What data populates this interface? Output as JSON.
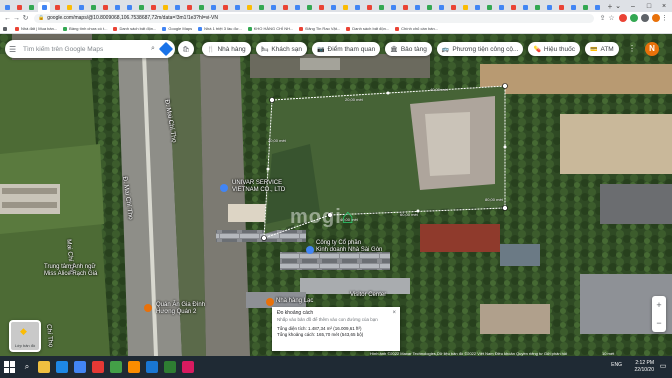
{
  "browser": {
    "url": "google.com/maps/@10.8009068,106.7538687,72m/data=!3m1!1e3?hl=vi-VN",
    "tab_favicon_colors": [
      "#4285f4",
      "#ea4335",
      "#34a853",
      "#4285f4",
      "#ea4335",
      "#fbbc04",
      "#4285f4",
      "#34a853",
      "#ea4335",
      "#4285f4",
      "#4285f4",
      "#34a853",
      "#ea4335",
      "#fbbc04",
      "#4285f4",
      "#ea4335",
      "#34a853",
      "#4285f4",
      "#ea4335",
      "#4285f4",
      "#fbbc04",
      "#34a853",
      "#4285f4",
      "#ea4335",
      "#4285f4",
      "#34a853",
      "#ea4335",
      "#4285f4",
      "#fbbc04",
      "#4285f4",
      "#ea4335",
      "#34a853",
      "#4285f4",
      "#ea4335",
      "#4285f4",
      "#34a853",
      "#4285f4",
      "#ea4335",
      "#fbbc04",
      "#4285f4",
      "#34a853",
      "#4285f4",
      "#ea4335",
      "#4285f4",
      "#34a853",
      "#4285f4",
      "#ea4335",
      "#4285f4",
      "#34a853",
      "#4285f4"
    ],
    "bookmarks": [
      {
        "label": "Nhà đất | Mua bán...",
        "style": "red"
      },
      {
        "label": "Bảng tính chưa có t...",
        "style": "green"
      },
      {
        "label": "Danh sách bất độn...",
        "style": "red"
      },
      {
        "label": "Google Maps",
        "style": "blue"
      },
      {
        "label": "Nhà 1 triệt 3 lầu đư...",
        "style": "blue"
      },
      {
        "label": "KHO HÀNG CHÍ NH...",
        "style": "green"
      },
      {
        "label": "Đăng Tin Rao Vặt...",
        "style": "red"
      },
      {
        "label": "Danh sách bất độn...",
        "style": "red"
      },
      {
        "label": "Chính chủ cần bán...",
        "style": "red"
      }
    ],
    "other_bookmarks": "Dấu trang khác"
  },
  "maps": {
    "search_placeholder": "Tìm kiếm trên Google Maps",
    "chips": [
      {
        "icon": "restaurant-icon",
        "glyph": "🍴",
        "label": "Nhà hàng"
      },
      {
        "icon": "hotel-icon",
        "glyph": "🛏",
        "label": "Khách sạn"
      },
      {
        "icon": "camera-icon",
        "glyph": "📷",
        "label": "Điểm tham quan"
      },
      {
        "icon": "museum-icon",
        "glyph": "🏛",
        "label": "Bảo tàng"
      },
      {
        "icon": "transit-icon",
        "glyph": "🚌",
        "label": "Phương tiện công cộ..."
      },
      {
        "icon": "pharmacy-icon",
        "glyph": "💊",
        "label": "Hiệu thuốc"
      },
      {
        "icon": "atm-icon",
        "glyph": "💳",
        "label": "ATM"
      }
    ],
    "avatar_letter": "N",
    "roads": [
      "Đ. Mai Chí Thọ",
      "Đ. Mai Chí Thọ",
      "Mai Chí Thọ",
      "Chí Thọ"
    ],
    "places": [
      {
        "name": "UNIVAR SERVICE",
        "sub": "VIETNAM CO., LTD"
      },
      {
        "name": "Công ty Cổ phần",
        "sub": "Kinh doanh Nhà Sài Gòn"
      },
      {
        "name": "Trung tâm Anh ngữ",
        "sub": "Miss Alice Rạch Giá"
      },
      {
        "name": "Quán Ăn Gia Đình",
        "sub": "Hương Quán 2"
      },
      {
        "name": "Nhà hàng Lạc"
      },
      {
        "name": "Visitor Center"
      }
    ],
    "measure_labels": [
      "20,00 mét",
      "40,00 mét",
      "60,00 mét",
      "80,00 mét",
      "20,00 mét",
      "40,00 mét"
    ],
    "watermark": "mogi",
    "measure_box": {
      "title": "Đo khoảng cách",
      "subtitle": "Nhấp vào bản đồ để thêm vào con đường của bạn",
      "area": "Tổng diện tích: 1.487,34 m² (16.009,61 ft²)",
      "distance": "Tổng khoảng cách: 165,70 mét (543,65 bộ)"
    },
    "layers_label": "Lớp bản đồ",
    "attribution": "Hình ảnh ©2022 Maxar Technologies,Dữ liệu bản đồ ©2022   Việt Nam   Điều khoản   Quyền riêng tư   Gửi phản hồi",
    "scale": "10 mét"
  },
  "taskbar": {
    "time": "2:12 PM",
    "date": "22/10/20",
    "lang": "ENG",
    "app_colors": [
      "#f0c040",
      "#1e88e5",
      "#4285f4",
      "#e53935",
      "#43a047",
      "#fb8c00",
      "#1976d2",
      "#2e7d32",
      "#d81b60"
    ]
  }
}
